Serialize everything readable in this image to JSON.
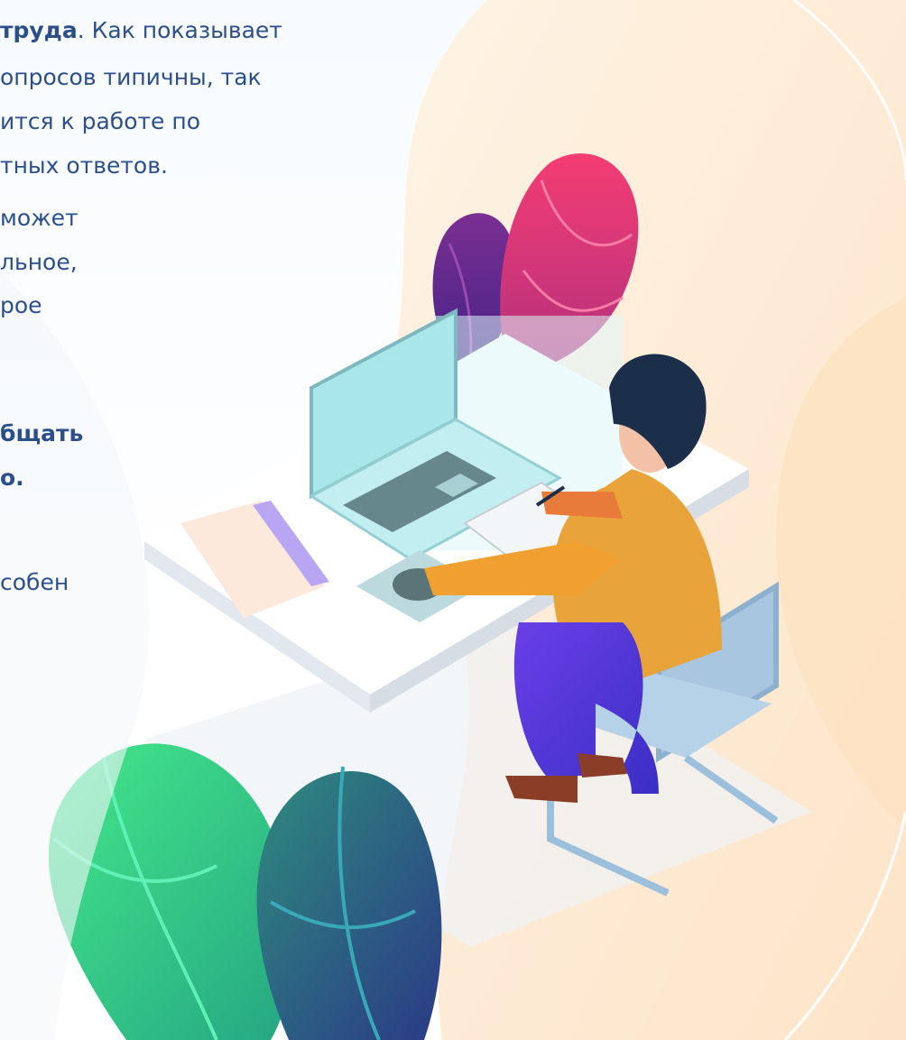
{
  "slide": {
    "lines": [
      {
        "bold": "труда",
        "rest": ". Как показывает"
      },
      {
        "text": "опросов типичны, так"
      },
      {
        "text": "ится к работе по"
      },
      {
        "text": "тных ответов."
      },
      {
        "text": "может"
      },
      {
        "text": "льное,"
      },
      {
        "text": "рое"
      },
      {
        "text": "бщать"
      },
      {
        "text": "о."
      },
      {
        "text": "собен"
      }
    ]
  },
  "colors": {
    "text": "#2c4f8c",
    "leaf_pink": "#e8336f",
    "leaf_purple": "#6b2a8c",
    "leaf_green": "#3dd68c",
    "leaf_teal": "#2a7f8a",
    "shirt": "#f0a030",
    "pants": "#5a3fd6",
    "hair": "#1c2f4a",
    "laptop": "#a8e8ec",
    "chair": "#9cc0dc",
    "peach_bg": "#fde8cf"
  },
  "icons": {
    "illustration": "person-at-desk-illustration"
  }
}
